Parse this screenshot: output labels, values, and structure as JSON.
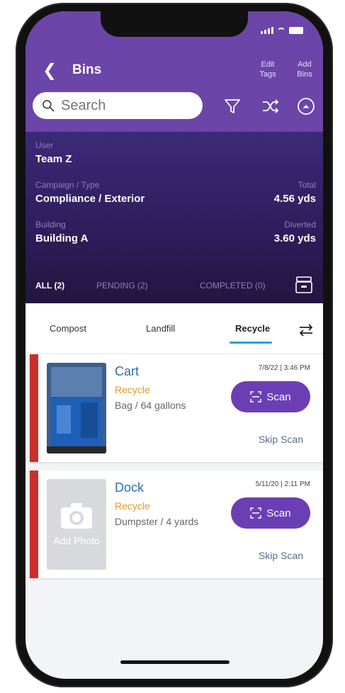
{
  "nav": {
    "title": "Bins",
    "edit_tags": "Edit Tags",
    "add_bins": "Add Bins"
  },
  "search": {
    "placeholder": "Search"
  },
  "info": {
    "user_label": "User",
    "user_value": "Team Z",
    "campaign_label": "Campaign / Type",
    "campaign_value": "Compliance / Exterior",
    "total_label": "Total",
    "total_value": "4.56 yds",
    "building_label": "Building",
    "building_value": "Building A",
    "diverted_label": "Diverted",
    "diverted_value": "3.60 yds"
  },
  "filters": {
    "all": "ALL (2)",
    "pending": "PENDING (2)",
    "completed": "COMPLETED (0)"
  },
  "streams": {
    "compost": "Compost",
    "landfill": "Landfill",
    "recycle": "Recycle"
  },
  "bins": [
    {
      "name": "Cart",
      "stream": "Recycle",
      "size": "Bag / 64 gallons",
      "timestamp": "7/8/22 | 3:46 PM",
      "scan_label": "Scan",
      "skip_label": "Skip Scan"
    },
    {
      "name": "Dock",
      "stream": "Recycle",
      "size": "Dumpster / 4 yards",
      "timestamp": "5/11/20 | 2:11 PM",
      "scan_label": "Scan",
      "skip_label": "Skip Scan",
      "photo_label": "Add Photo"
    }
  ],
  "colors": {
    "header": "#6b45a8",
    "accent": "#6b3fb3",
    "flag": "#c9302c",
    "bin_name": "#2b6fb3",
    "stream": "#e09a2a",
    "underline": "#2ca0d6"
  }
}
